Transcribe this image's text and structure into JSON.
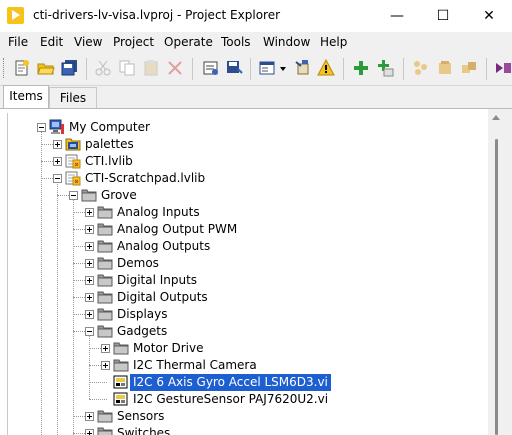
{
  "window": {
    "title": "cti-drivers-lv-visa.lvproj - Project Explorer",
    "minimize": "—",
    "maximize": "☐",
    "close": "✕"
  },
  "menu": [
    "File",
    "Edit",
    "View",
    "Project",
    "Operate",
    "Tools",
    "Window",
    "Help"
  ],
  "toolbar": {
    "icons": [
      "new-icon",
      "open-icon",
      "save-all-icon",
      "cut-icon",
      "copy-icon",
      "paste-icon",
      "delete-icon",
      "build-icon",
      "save-icon",
      "view-icon",
      "dropdown-icon",
      "settings-icon",
      "warning-icon",
      "add-icon",
      "add-folder-icon",
      "properties-icon"
    ]
  },
  "tabs": [
    {
      "label": "Items",
      "active": true
    },
    {
      "label": "Files",
      "active": false
    }
  ],
  "tree": [
    {
      "label": "My Computer",
      "level": 0,
      "expander": "minus",
      "icon": "computer-icon"
    },
    {
      "label": "palettes",
      "level": 1,
      "expander": "plus",
      "icon": "virtual-folder-icon"
    },
    {
      "label": "CTI.lvlib",
      "level": 1,
      "expander": "plus",
      "icon": "library-icon"
    },
    {
      "label": "CTI-Scratchpad.lvlib",
      "level": 1,
      "expander": "minus",
      "icon": "library-icon"
    },
    {
      "label": "Grove",
      "level": 2,
      "expander": "minus",
      "icon": "folder-icon"
    },
    {
      "label": "Analog Inputs",
      "level": 3,
      "expander": "plus",
      "icon": "folder-icon"
    },
    {
      "label": "Analog Output PWM",
      "level": 3,
      "expander": "plus",
      "icon": "folder-icon"
    },
    {
      "label": "Analog Outputs",
      "level": 3,
      "expander": "plus",
      "icon": "folder-icon"
    },
    {
      "label": "Demos",
      "level": 3,
      "expander": "plus",
      "icon": "folder-icon"
    },
    {
      "label": "Digital Inputs",
      "level": 3,
      "expander": "plus",
      "icon": "folder-icon"
    },
    {
      "label": "Digital Outputs",
      "level": 3,
      "expander": "plus",
      "icon": "folder-icon"
    },
    {
      "label": "Displays",
      "level": 3,
      "expander": "plus",
      "icon": "folder-icon"
    },
    {
      "label": "Gadgets",
      "level": 3,
      "expander": "minus",
      "icon": "folder-icon"
    },
    {
      "label": "Motor Drive",
      "level": 4,
      "expander": "plus",
      "icon": "folder-icon"
    },
    {
      "label": "I2C Thermal Camera",
      "level": 4,
      "expander": "plus",
      "icon": "folder-icon"
    },
    {
      "label": "I2C 6 Axis Gyro Accel LSM6D3.vi",
      "level": 4,
      "expander": "none",
      "icon": "vi-icon",
      "selected": true
    },
    {
      "label": "I2C GestureSensor PAJ7620U2.vi",
      "level": 4,
      "expander": "none",
      "icon": "vi-icon"
    },
    {
      "label": "Sensors",
      "level": 3,
      "expander": "plus",
      "icon": "folder-icon"
    },
    {
      "label": "Switches",
      "level": 3,
      "expander": "plus",
      "icon": "folder-icon"
    }
  ],
  "colors": {
    "selection": "#1d5fd0",
    "folder": "#8f8f8f",
    "library": "#f6c21c"
  }
}
